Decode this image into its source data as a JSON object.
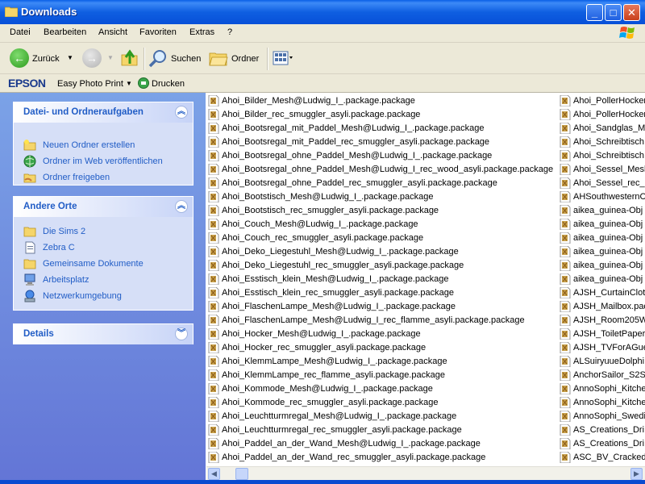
{
  "window": {
    "title": "Downloads"
  },
  "menu": [
    "Datei",
    "Bearbeiten",
    "Ansicht",
    "Favoriten",
    "Extras",
    "?"
  ],
  "toolbar": {
    "back_label": "Zurück",
    "search_label": "Suchen",
    "folders_label": "Ordner"
  },
  "epson_bar": {
    "brand": "EPSON",
    "easy_photo_print": "Easy Photo Print",
    "print_label": "Drucken"
  },
  "panels": {
    "tasks": {
      "title": "Datei- und Ordneraufgaben",
      "items": [
        "Neuen Ordner erstellen",
        "Ordner im Web veröffentlichen",
        "Ordner freigeben"
      ]
    },
    "places": {
      "title": "Andere Orte",
      "items": [
        "Die Sims 2",
        "Zebra C",
        "Gemeinsame Dokumente",
        "Arbeitsplatz",
        "Netzwerkumgebung"
      ]
    },
    "details": {
      "title": "Details"
    }
  },
  "files": {
    "col1": [
      "Ahoi_Bilder_Mesh@Ludwig_I_.package.package",
      "Ahoi_Bilder_rec_smuggler_asyli.package.package",
      "Ahoi_Bootsregal_mit_Paddel_Mesh@Ludwig_I_.package.package",
      "Ahoi_Bootsregal_mit_Paddel_rec_smuggler_asyli.package.package",
      "Ahoi_Bootsregal_ohne_Paddel_Mesh@Ludwig_I_.package.package",
      "Ahoi_Bootsregal_ohne_Paddel_Mesh@Ludwig_I_rec_wood_asyli.package.package",
      "Ahoi_Bootsregal_ohne_Paddel_rec_smuggler_asyli.package.package",
      "Ahoi_Bootstisch_Mesh@Ludwig_I_.package.package",
      "Ahoi_Bootstisch_rec_smuggler_asyli.package.package",
      "Ahoi_Couch_Mesh@Ludwig_I_.package.package",
      "Ahoi_Couch_rec_smuggler_asyli.package.package",
      "Ahoi_Deko_Liegestuhl_Mesh@Ludwig_I_.package.package",
      "Ahoi_Deko_Liegestuhl_rec_smuggler_asyli.package.package",
      "Ahoi_Esstisch_klein_Mesh@Ludwig_I_.package.package",
      "Ahoi_Esstisch_klein_rec_smuggler_asyli.package.package",
      "Ahoi_FlaschenLampe_Mesh@Ludwig_I_.package.package",
      "Ahoi_FlaschenLampe_Mesh@Ludwig_I_rec_flamme_asyli.package.package",
      "Ahoi_Hocker_Mesh@Ludwig_I_.package.package",
      "Ahoi_Hocker_rec_smuggler_asyli.package.package",
      "Ahoi_KlemmLampe_Mesh@Ludwig_I_.package.package",
      "Ahoi_KlemmLampe_rec_flamme_asyli.package.package",
      "Ahoi_Kommode_Mesh@Ludwig_I_.package.package",
      "Ahoi_Kommode_rec_smuggler_asyli.package.package",
      "Ahoi_Leuchtturmregal_Mesh@Ludwig_I_.package.package",
      "Ahoi_Leuchtturmregal_rec_smuggler_asyli.package.package",
      "Ahoi_Paddel_an_der_Wand_Mesh@Ludwig_I_.package.package",
      "Ahoi_Paddel_an_der_Wand_rec_smuggler_asyli.package.package"
    ],
    "col2": [
      "Ahoi_PollerHocker",
      "Ahoi_PollerHocker",
      "Ahoi_Sandglas_M",
      "Ahoi_Schreibtisch",
      "Ahoi_Schreibtisch",
      "Ahoi_Sessel_Mesh",
      "Ahoi_Sessel_rec_",
      "AHSouthwesternC",
      "aikea_guinea-Obj",
      "aikea_guinea-Obj",
      "aikea_guinea-Obj",
      "aikea_guinea-Obj",
      "aikea_guinea-Obj",
      "aikea_guinea-Obj",
      "AJSH_CurtainClot",
      "AJSH_Mailbox.pac",
      "AJSH_Room205W",
      "AJSH_ToiletPaper",
      "AJSH_TVForAGue",
      "ALSuiryuueDolphi",
      "AnchorSailor_S2S",
      "AnnoSophi_Kitche",
      "AnnoSophi_Kitche",
      "AnnoSophi_Swedi",
      "AS_Creations_Dri",
      "AS_Creations_Dri",
      "ASC_BV_Cracked"
    ]
  },
  "colors": {
    "titlebar": "#0a5fe6",
    "link": "#215dc6",
    "pane_top": "#7ba2e7",
    "pane_bottom": "#6375d6"
  }
}
